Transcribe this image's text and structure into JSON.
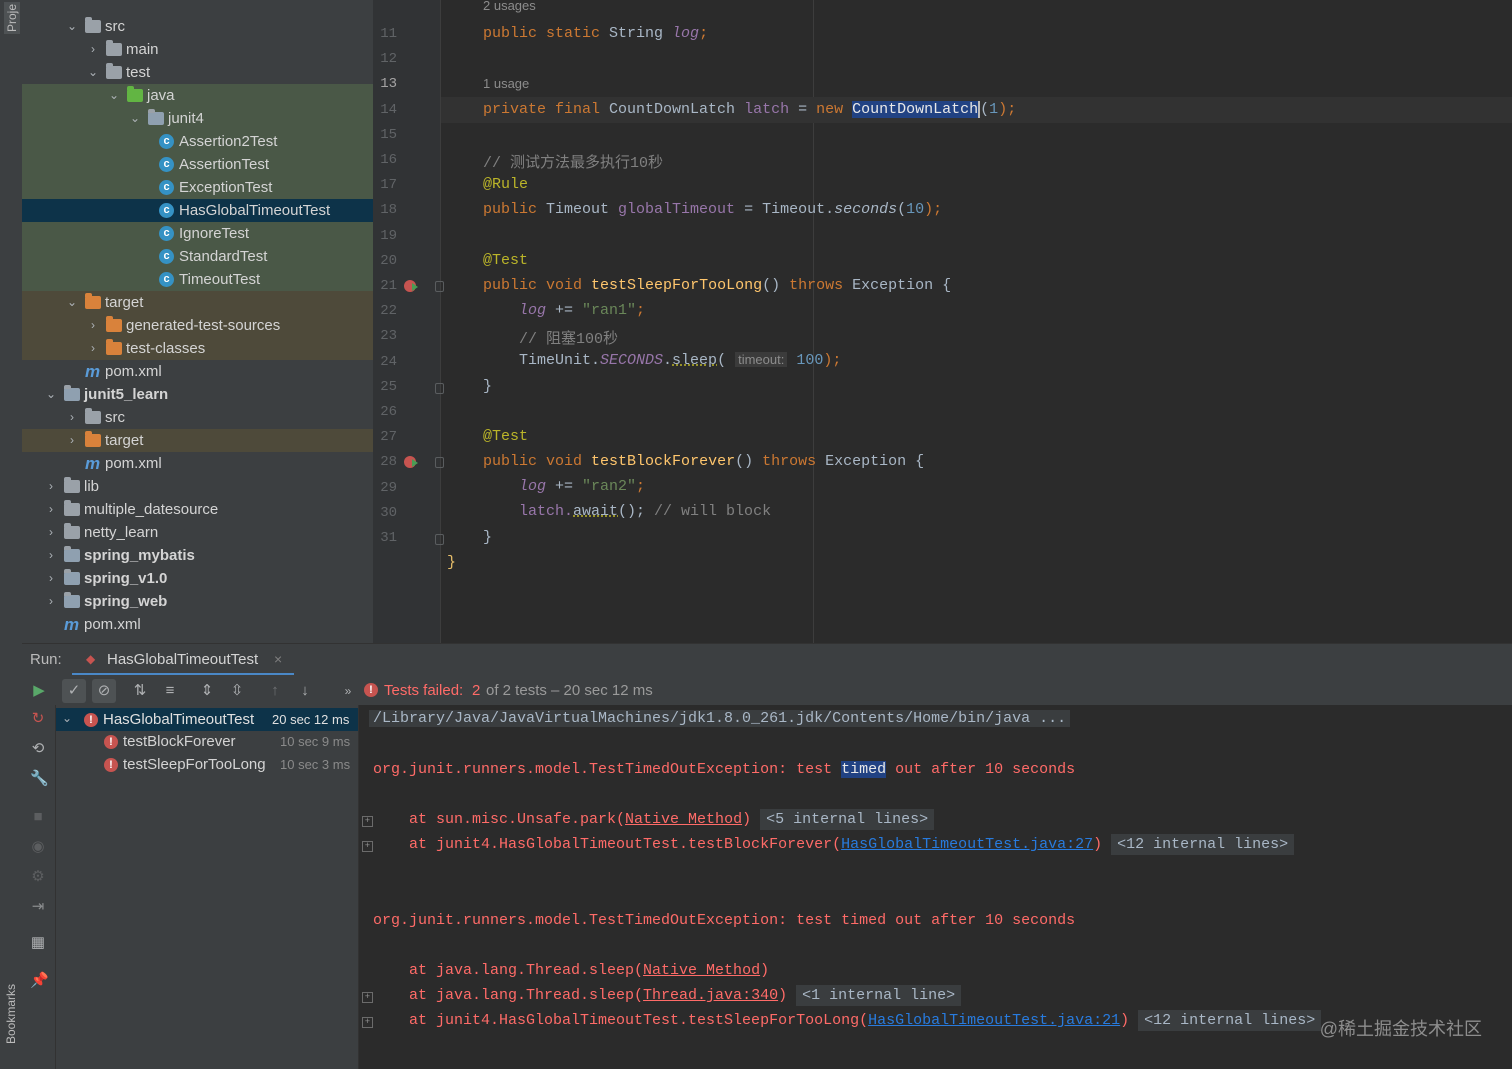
{
  "sidebar": {
    "project_label": "Proje",
    "bookmarks_label": "Bookmarks"
  },
  "project_tree": [
    {
      "label": "src",
      "depth": 2,
      "expanded": true,
      "icon": "folder-icon"
    },
    {
      "label": "main",
      "depth": 3,
      "expanded": false,
      "icon": "folder-icon"
    },
    {
      "label": "test",
      "depth": 3,
      "expanded": true,
      "icon": "folder-icon"
    },
    {
      "label": "java",
      "depth": 4,
      "expanded": true,
      "icon": "test-folder-icon"
    },
    {
      "label": "junit4",
      "depth": 5,
      "expanded": true,
      "icon": "package-icon"
    },
    {
      "label": "Assertion2Test",
      "depth": 6,
      "icon": "class-icon"
    },
    {
      "label": "AssertionTest",
      "depth": 6,
      "icon": "class-icon"
    },
    {
      "label": "ExceptionTest",
      "depth": 6,
      "icon": "class-icon"
    },
    {
      "label": "HasGlobalTimeoutTest",
      "depth": 6,
      "icon": "class-icon",
      "selected": true
    },
    {
      "label": "IgnoreTest",
      "depth": 6,
      "icon": "class-icon"
    },
    {
      "label": "StandardTest",
      "depth": 6,
      "icon": "class-icon"
    },
    {
      "label": "TimeoutTest",
      "depth": 6,
      "icon": "class-icon"
    },
    {
      "label": "target",
      "depth": 2,
      "expanded": true,
      "icon": "excluded-folder-icon"
    },
    {
      "label": "generated-test-sources",
      "depth": 3,
      "expanded": false,
      "icon": "excluded-folder-icon"
    },
    {
      "label": "test-classes",
      "depth": 3,
      "expanded": false,
      "icon": "excluded-folder-icon"
    },
    {
      "label": "pom.xml",
      "depth": 2,
      "icon": "maven-icon"
    },
    {
      "label": "junit5_learn",
      "depth": 1,
      "expanded": true,
      "icon": "module-icon",
      "bold": true
    },
    {
      "label": "src",
      "depth": 2,
      "expanded": false,
      "icon": "folder-icon"
    },
    {
      "label": "target",
      "depth": 2,
      "expanded": false,
      "icon": "excluded-folder-icon"
    },
    {
      "label": "pom.xml",
      "depth": 2,
      "icon": "maven-icon"
    },
    {
      "label": "lib",
      "depth": 1,
      "expanded": false,
      "icon": "folder-icon"
    },
    {
      "label": "multiple_datesource",
      "depth": 1,
      "expanded": false,
      "icon": "folder-icon"
    },
    {
      "label": "netty_learn",
      "depth": 1,
      "expanded": false,
      "icon": "folder-icon"
    },
    {
      "label": "spring_mybatis",
      "depth": 1,
      "expanded": false,
      "icon": "module-icon",
      "bold": true
    },
    {
      "label": "spring_v1.0",
      "depth": 1,
      "expanded": false,
      "icon": "module-icon",
      "bold": true
    },
    {
      "label": "spring_web",
      "depth": 1,
      "expanded": false,
      "icon": "module-icon",
      "bold": true
    },
    {
      "label": "pom.xml",
      "depth": 1,
      "icon": "maven-icon"
    }
  ],
  "editor": {
    "line_numbers": [
      "11",
      "12",
      "13",
      "14",
      "15",
      "16",
      "17",
      "18",
      "19",
      "20",
      "21",
      "22",
      "23",
      "24",
      "25",
      "26",
      "27",
      "28",
      "29",
      "30",
      "31"
    ],
    "usage_hints": {
      "top": "2 usages",
      "line13": "1 usage"
    },
    "code": {
      "l11_kw": "public static",
      "l11_type": " String ",
      "l11_fld": "log",
      "l11_end": ";",
      "l13_kw": "private final",
      "l13_a": " CountDownLatch ",
      "l13_fld": "latch",
      "l13_b": " = ",
      "l13_new": "new",
      "l13_sp": " ",
      "l13_cls": "CountDownLatch",
      "l13_c": "(",
      "l13_num": "1",
      "l13_end": ");",
      "l15_cmt": "// 测试方法最多执行10秒",
      "l16_ann": "@Rule",
      "l17_kw": "public",
      "l17_a": " Timeout ",
      "l17_fld": "globalTimeout",
      "l17_b": " = Timeout.",
      "l17_m": "seconds",
      "l17_c": "(",
      "l17_num": "10",
      "l17_end": ");",
      "l19_ann": "@Test",
      "l20_kw": "public void",
      "l20_sp": " ",
      "l20_fn": "testSleepForTooLong",
      "l20_a": "() ",
      "l20_throws": "throws",
      "l20_b": " Exception {",
      "l21_fld": "log",
      "l21_a": " += ",
      "l21_str": "\"ran1\"",
      "l21_end": ";",
      "l22_cmt": "// 阻塞100秒",
      "l23_a": "TimeUnit.",
      "l23_const": "SECONDS",
      "l23_b": ".",
      "l23_m": "sleep",
      "l23_c": "( ",
      "l23_hint": "timeout:",
      "l23_sp": " ",
      "l23_num": "100",
      "l23_end": ");",
      "l24": "}",
      "l26_ann": "@Test",
      "l27_kw": "public void",
      "l27_sp": " ",
      "l27_fn": "testBlockForever",
      "l27_a": "() ",
      "l27_throws": "throws",
      "l27_b": " Exception {",
      "l28_fld": "log",
      "l28_a": " += ",
      "l28_str": "\"ran2\"",
      "l28_end": ";",
      "l29_a": "latch.",
      "l29_m": "await",
      "l29_b": "(); ",
      "l29_cmt": "// will block",
      "l30": "}",
      "l31": "}"
    }
  },
  "run": {
    "label": "Run:",
    "tab": "HasGlobalTimeoutTest",
    "status_failed": "Tests failed:",
    "status_count": "2",
    "status_rest": "of 2 tests – 20 sec 12 ms",
    "tests": [
      {
        "name": "HasGlobalTimeoutTest",
        "time": "20 sec 12 ms",
        "selected": true
      },
      {
        "name": "testBlockForever",
        "time": "10 sec 9 ms"
      },
      {
        "name": "testSleepForTooLong",
        "time": "10 sec 3 ms"
      }
    ]
  },
  "console": {
    "cmd": "/Library/Java/JavaVirtualMachines/jdk1.8.0_261.jdk/Contents/Home/bin/java ...",
    "ex1_a": "org.junit.runners.model.TestTimedOutException: test ",
    "ex1_hl": "timed",
    "ex1_b": " out after 10 seconds",
    "s1_a": "    at sun.misc.Unsafe.park(",
    "s1_link": "Native Method",
    "s1_b": ")",
    "s1_fold": "<5 internal lines>",
    "s2_a": "    at junit4.HasGlobalTimeoutTest.testBlockForever(",
    "s2_link": "HasGlobalTimeoutTest.java:27",
    "s2_b": ")",
    "s2_fold": "<12 internal lines>",
    "ex2": "org.junit.runners.model.TestTimedOutException: test timed out after 10 seconds",
    "s3_a": "    at java.lang.Thread.sleep(",
    "s3_link": "Native Method",
    "s3_b": ")",
    "s4_a": "    at java.lang.Thread.sleep(",
    "s4_link": "Thread.java:340",
    "s4_b": ")",
    "s4_fold": "<1 internal line>",
    "s5_a": "    at junit4.HasGlobalTimeoutTest.testSleepForTooLong(",
    "s5_link": "HasGlobalTimeoutTest.java:21",
    "s5_b": ")",
    "s5_fold": "<12 internal lines>"
  },
  "watermark": "@稀土掘金技术社区"
}
